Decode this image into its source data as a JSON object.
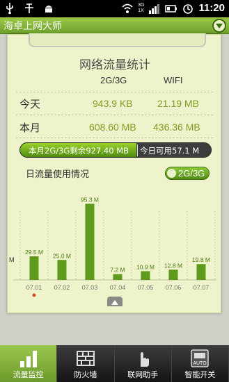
{
  "status_bar": {
    "time": "11:20",
    "network_type": "3G",
    "network_sub": "1X",
    "icons": [
      "usb-icon",
      "debug-icon",
      "android-icon",
      "wifi-icon",
      "signal-icon",
      "battery-icon",
      "alarm-icon"
    ]
  },
  "app": {
    "title": "海卓上网大师"
  },
  "card": {
    "title": "网络流量统计",
    "col_mobile": "2G/3G",
    "col_wifi": "WIFI",
    "rows": [
      {
        "label": "今天",
        "mobile": "943.9 KB",
        "wifi": "21.19 MB"
      },
      {
        "label": "本月",
        "mobile": "608.60 MB",
        "wifi": "436.36 MB"
      }
    ],
    "progress": {
      "left_text": "本月2G/3G剩余927.40 MB",
      "right_text": "今日可用57.1 M",
      "fill_fraction": 0.61
    },
    "daily_label": "日流量使用情况",
    "toggle_label": "2G/3G"
  },
  "chart_data": {
    "type": "bar",
    "categories": [
      "07.01",
      "07.02",
      "07.03",
      "07.04",
      "07.05",
      "07.06",
      "07.07"
    ],
    "values": [
      29.5,
      25.0,
      95.3,
      7.2,
      10.9,
      12.8,
      19.8
    ],
    "data_labels": [
      "29.5 M",
      "25.0 M",
      "95.3 M",
      "7.2 M",
      "10.9 M",
      "12.8 M",
      "19.8 M"
    ],
    "y_axis_label": "M",
    "ylim": [
      0,
      100
    ],
    "highlight_category": "07.01",
    "bar_color": "#5e9a1c"
  },
  "bottom_nav": {
    "items": [
      {
        "label": "流量监控",
        "icon": "bars-icon",
        "active": true
      },
      {
        "label": "防火墙",
        "icon": "firewall-icon",
        "active": false
      },
      {
        "label": "联网助手",
        "icon": "hand-icon",
        "active": false
      },
      {
        "label": "智能开关",
        "icon": "auto-switch-icon",
        "active": false
      }
    ],
    "auto_badge": "AUTO"
  },
  "colors": {
    "accent": "#6ea12c",
    "value_green": "#7e9b22",
    "card_bg": "#eef3cb"
  }
}
